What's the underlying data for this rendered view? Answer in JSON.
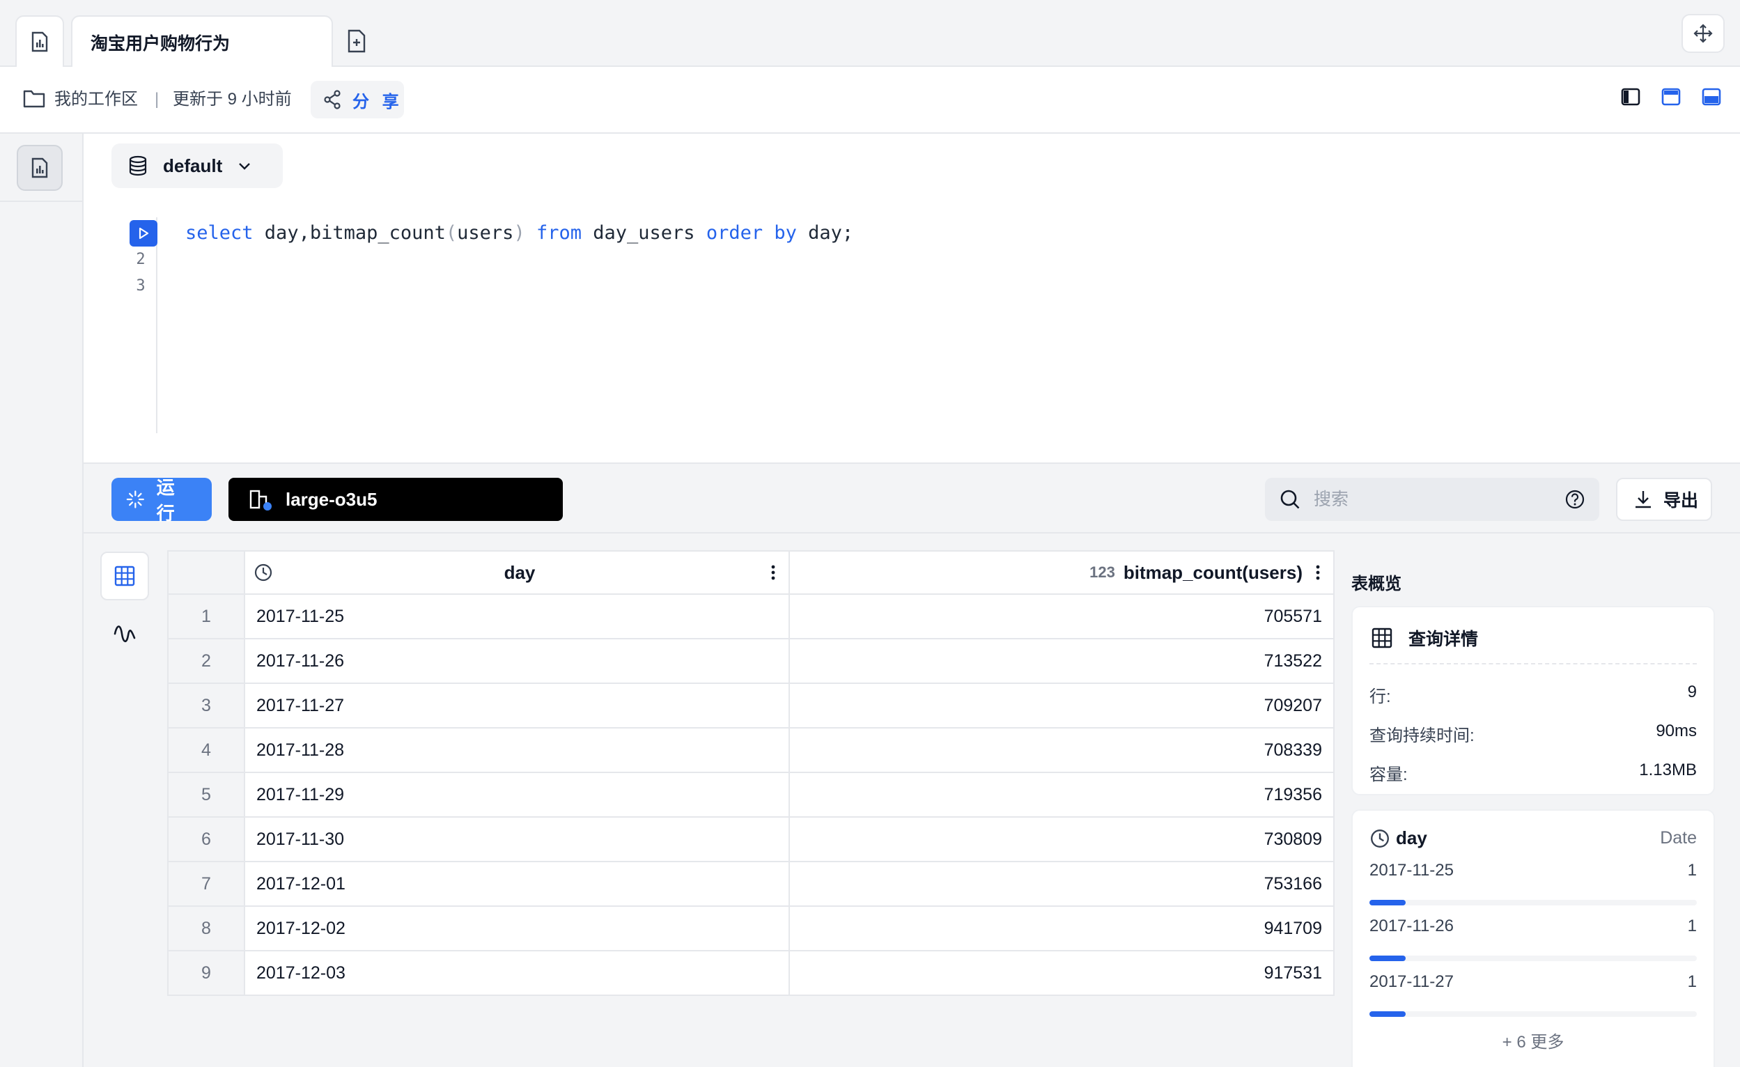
{
  "tabs": {
    "active_title": "淘宝用户购物行为"
  },
  "breadcrumb": {
    "workspace": "我的工作区",
    "separator": "|",
    "updated": "更新于 9 小时前",
    "share_label": "分 享"
  },
  "editor": {
    "database": "default",
    "line_numbers": [
      "2",
      "3"
    ],
    "code": {
      "kw_select": "select",
      "part1": " day,bitmap_count",
      "lp": "(",
      "arg": "users",
      "rp": ")",
      "kw_from": "from",
      "table": " day_users ",
      "kw_order": "order",
      "kw_by": "by",
      "tail": " day;"
    }
  },
  "actions": {
    "run_label": "运 行",
    "cluster_name": "large-o3u5",
    "search_placeholder": "搜索",
    "export_label": "导出"
  },
  "results": {
    "columns": [
      {
        "name": "day",
        "type_badge": ""
      },
      {
        "name": "bitmap_count(users)",
        "type_badge": "123"
      }
    ],
    "rows": [
      {
        "n": "1",
        "day": "2017-11-25",
        "count": "705571"
      },
      {
        "n": "2",
        "day": "2017-11-26",
        "count": "713522"
      },
      {
        "n": "3",
        "day": "2017-11-27",
        "count": "709207"
      },
      {
        "n": "4",
        "day": "2017-11-28",
        "count": "708339"
      },
      {
        "n": "5",
        "day": "2017-11-29",
        "count": "719356"
      },
      {
        "n": "6",
        "day": "2017-11-30",
        "count": "730809"
      },
      {
        "n": "7",
        "day": "2017-12-01",
        "count": "753166"
      },
      {
        "n": "8",
        "day": "2017-12-02",
        "count": "941709"
      },
      {
        "n": "9",
        "day": "2017-12-03",
        "count": "917531"
      }
    ]
  },
  "overview": {
    "title": "表概览",
    "query_details": {
      "heading": "查询详情",
      "rows_label": "行:",
      "rows_value": "9",
      "duration_label": "查询持续时间:",
      "duration_value": "90ms",
      "size_label": "容量:",
      "size_value": "1.13MB"
    },
    "column_summary": {
      "name": "day",
      "type": "Date",
      "values": [
        {
          "label": "2017-11-25",
          "count": "1",
          "fraction": 0.111
        },
        {
          "label": "2017-11-26",
          "count": "1",
          "fraction": 0.111
        },
        {
          "label": "2017-11-27",
          "count": "1",
          "fraction": 0.111
        }
      ],
      "more": "+ 6 更多"
    }
  },
  "colors": {
    "accent": "#2563eb",
    "run_button": "#3b82f6",
    "cluster_button": "#000000"
  }
}
